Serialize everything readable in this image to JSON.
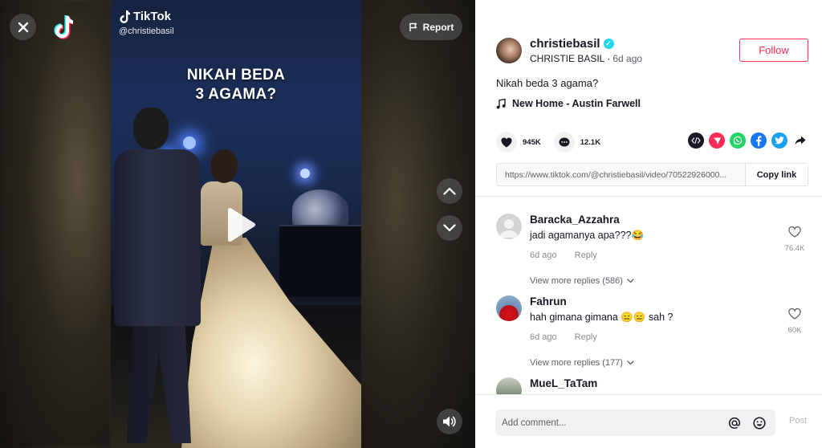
{
  "video": {
    "overlay_line1": "NIKAH BEDA",
    "overlay_line2": "3 AGAMA?",
    "watermark_brand": "TikTok",
    "watermark_user": "@christiebasil",
    "report_label": "Report"
  },
  "author": {
    "username": "christiebasil",
    "display_name": "CHRISTIE BASIL",
    "dot": "·",
    "time_ago": "6d ago",
    "follow_label": "Follow"
  },
  "post": {
    "description": "Nikah beda 3 agama?",
    "music": "New Home - Austin Farwell",
    "likes": "945K",
    "comments_count": "12.1K",
    "link": "https://www.tiktok.com/@christiebasil/video/70522926000...",
    "copy_label": "Copy link"
  },
  "share_icons": [
    "embed-icon",
    "send-to-friends-icon",
    "whatsapp-icon",
    "facebook-icon",
    "twitter-icon",
    "share-arrow-icon"
  ],
  "colors": {
    "accent": "#fe2c55",
    "verified": "#20d5ec",
    "whatsapp": "#25d366",
    "facebook": "#1877f2",
    "twitter": "#1da1f2",
    "send": "#fe2c55",
    "embed": "#161823"
  },
  "comments": [
    {
      "name": "Baracka_Azzahra",
      "text": "jadi agamanya apa???😂",
      "time": "6d ago",
      "reply": "Reply",
      "likes": "76.4K",
      "view_replies": "View more replies (586)"
    },
    {
      "name": "Fahrun",
      "text": "hah gimana gimana 😑😑 sah ?",
      "time": "6d ago",
      "reply": "Reply",
      "likes": "60K",
      "view_replies": "View more replies (177)"
    },
    {
      "name": "MueL_TaTam"
    }
  ],
  "compose": {
    "placeholder": "Add comment...",
    "post_label": "Post"
  }
}
